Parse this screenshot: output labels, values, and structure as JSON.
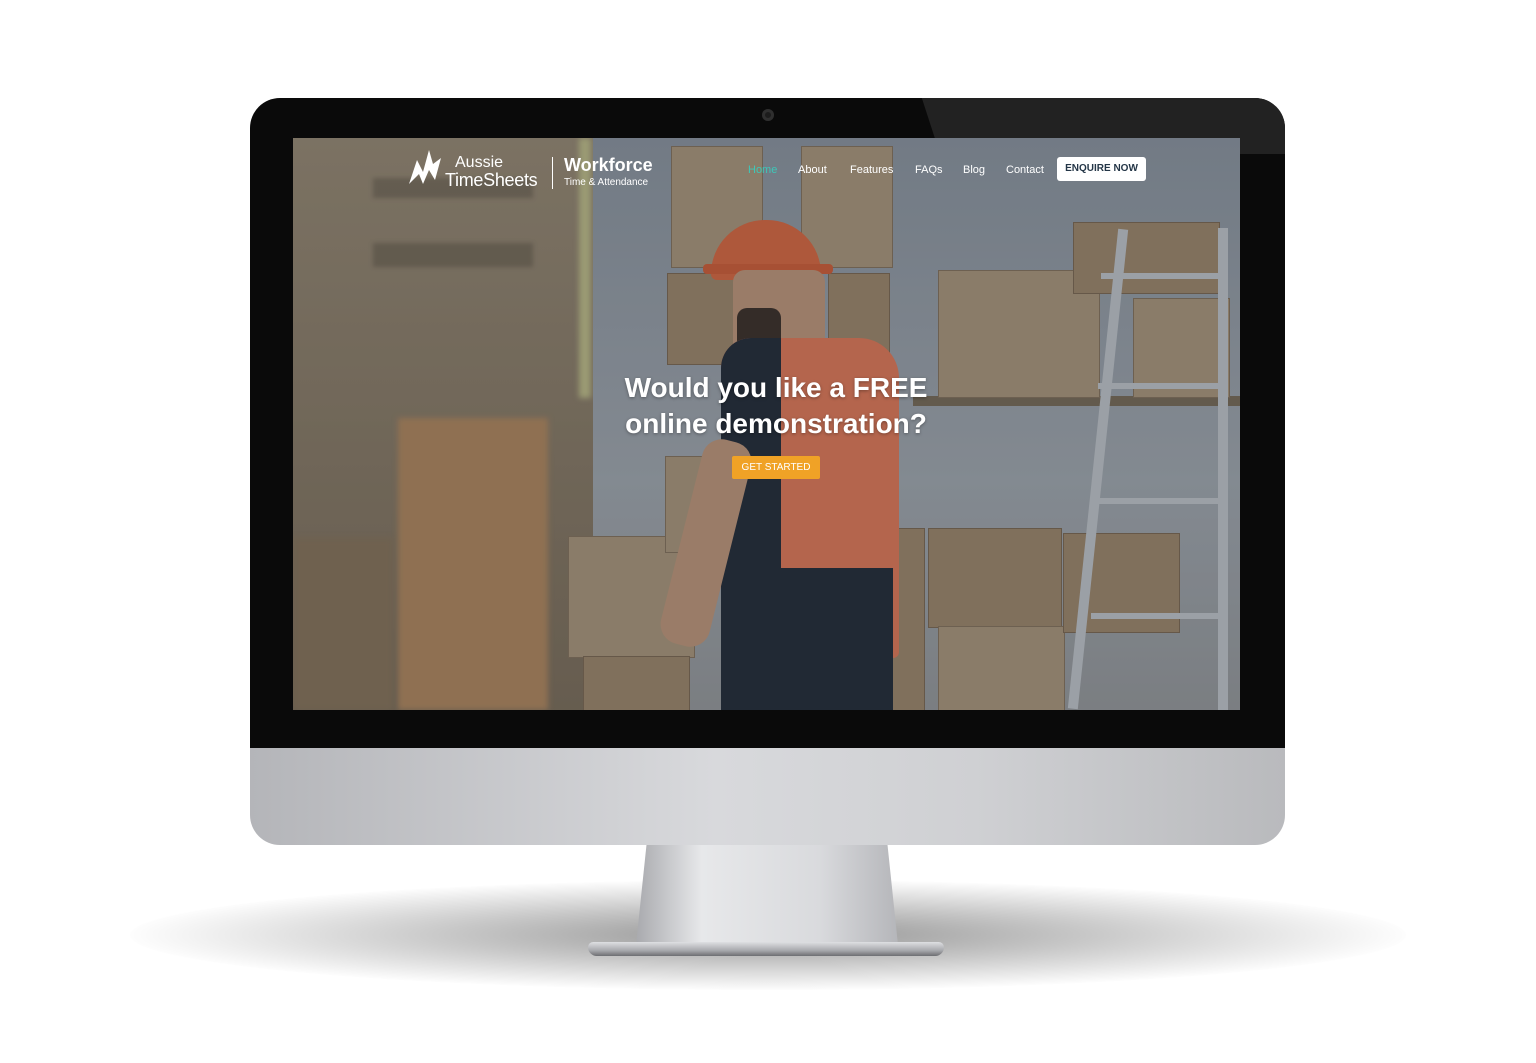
{
  "site": {
    "logo": {
      "line1": "Aussie",
      "line2": "TimeSheets"
    },
    "brand": {
      "title": "Workforce",
      "subtitle": "Time & Attendance"
    },
    "nav": {
      "items": [
        {
          "label": "Home",
          "active": true
        },
        {
          "label": "About"
        },
        {
          "label": "Features"
        },
        {
          "label": "FAQs"
        },
        {
          "label": "Blog"
        },
        {
          "label": "Contact"
        }
      ],
      "cta": "ENQUIRE NOW"
    },
    "hero": {
      "line1": "Would you like a FREE",
      "line2": "online demonstration?",
      "button": "GET STARTED"
    }
  },
  "colors": {
    "active_nav": "#3ec7b8",
    "cta": "#f0a226",
    "device_bezel": "#0a0a0a",
    "device_silver": "#d8d9dc"
  }
}
